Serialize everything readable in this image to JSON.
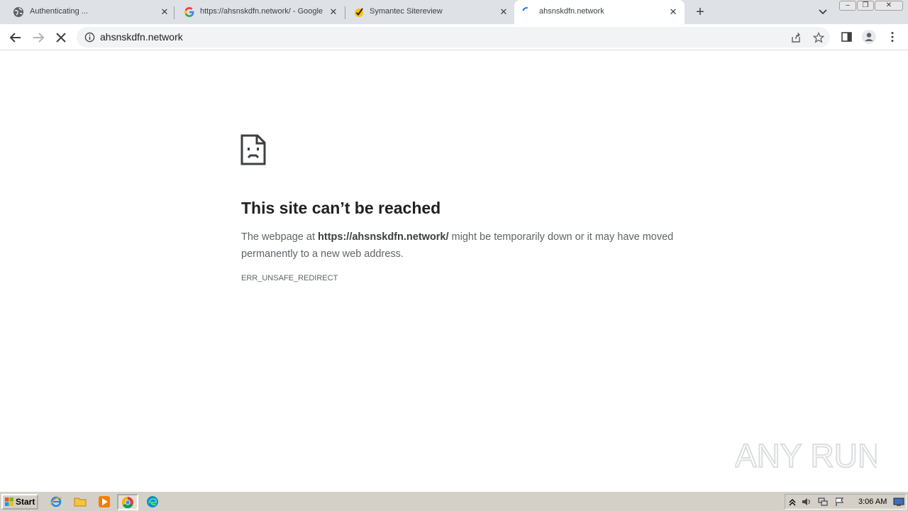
{
  "browser": {
    "tabs": [
      {
        "title": "Authenticating ...",
        "icon": "globe-icon"
      },
      {
        "title": "https://ahsnskdfn.network/ - Google",
        "icon": "google-icon"
      },
      {
        "title": "Symantec Sitereview",
        "icon": "symantec-icon"
      },
      {
        "title": "ahsnskdfn.network",
        "icon": "loading-spinner-icon",
        "active": true
      }
    ],
    "close_glyph": "✕",
    "new_tab_glyph": "+",
    "address": "ahsnskdfn.network",
    "window_controls": {
      "minimize": "–",
      "restore": "❐",
      "close": "✕"
    }
  },
  "error_page": {
    "heading": "This site can’t be reached",
    "desc_prefix": "The webpage at ",
    "desc_url": "https://ahsnskdfn.network/",
    "desc_suffix": " might be temporarily down or it may have moved permanently to a new web address.",
    "error_code": "ERR_UNSAFE_REDIRECT"
  },
  "watermark": {
    "text": "ANY RUN"
  },
  "taskbar": {
    "start_label": "Start",
    "clock": "3:06 AM",
    "pinned": [
      "ie-icon",
      "folder-icon",
      "media-player-icon",
      "chrome-icon",
      "edge-icon"
    ]
  },
  "colors": {
    "tabstrip": "#dee1e6",
    "omnibox": "#f1f3f4",
    "heading": "#202124",
    "text": "#5f6368",
    "taskbar": "#d4d0c8"
  }
}
